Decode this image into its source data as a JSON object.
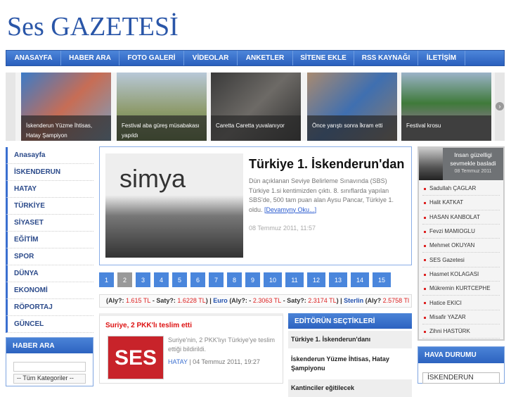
{
  "logo": "Ses GAZETESİ",
  "nav": [
    "ANASAYFA",
    "HABER ARA",
    "FOTO GALERİ",
    "VİDEOLAR",
    "ANKETLER",
    "SİTENE EKLE",
    "RSS KAYNAĞI",
    "İLETİŞİM"
  ],
  "slides": [
    "İskenderun Yüzme İhtisas, Hatay Şampiyon",
    "Festival aba güreş müsabakası yapıldı",
    "Caretta Caretta yuvalanıyor",
    "Önce yarıştı sonra İkram etti",
    "Festival krosu"
  ],
  "sidebar": [
    "Anasayfa",
    "İSKENDERUN",
    "HATAY",
    "TÜRKİYE",
    "SİYASET",
    "EĞİTİM",
    "SPOR",
    "DÜNYA",
    "EKONOMİ",
    "RÖPORTAJ",
    "GÜNCEL"
  ],
  "search": {
    "title": "HABER ARA",
    "category": "-- Tüm Kategoriler --"
  },
  "feature": {
    "title": "Türkiye 1. İskenderun'dan",
    "text": "Dün açıklanan Seviye Belirleme Sınavında (SBS) Türkiye 1.si kentimizden çıktı. 8. sınıflarda yapılan SBS'de, 500 tam puan alan Aysu Pancar, Türkiye 1. oldu.",
    "more": "[Devamyny Oku...]",
    "date": "08 Temmuz 2011, 11:57",
    "image_text": "simya"
  },
  "pages": [
    "1",
    "2",
    "3",
    "4",
    "5",
    "6",
    "7",
    "8",
    "9",
    "10",
    "11",
    "12",
    "13",
    "14",
    "15"
  ],
  "currency": {
    "a1": "(Aly?: ",
    "v1": "1.615 TL",
    "a2": " - Saty?: ",
    "v2": "1.6228 TL",
    "a3": ")  |  ",
    "euro": "Euro",
    "a4": " (Aly?: - ",
    "v3": "2.3063 TL",
    "a5": " - Saty?: ",
    "v4": "2.3174 TL",
    "a6": ")  |  ",
    "sterlin": "Sterlin",
    "a7": " (Aly? ",
    "v5": "2.5758 Tl"
  },
  "news": {
    "title": "Suriye, 2 PKK'lı teslim etti",
    "text": "Suriye'nin, 2 PKK'lıyı Türkiye'ye teslim ettiği bildirildi.",
    "category": "HATAY",
    "date": " | 04 Temmuz 2011, 19:27",
    "image_text": "SES"
  },
  "editor": {
    "title": "EDİTÖRÜN SEÇTİKLERİ",
    "items": [
      "Türkiye 1. İskenderun'danı",
      "İskenderun Yüzme İhtisas, Hatay Şampiyonu",
      "Kantinciler eğitilecek"
    ]
  },
  "author": {
    "headline": "Insan güzelligi sevmekle basladi",
    "date": "08 Temmuz 2011",
    "list": [
      "Sadullah ÇAGLAR",
      "Halit KATKAT",
      "HASAN KANBOLAT",
      "Fevzi MAMIOGLU",
      "Mehmet OKUYAN",
      "SES Gazetesi",
      "Hasmet KOLAGASI",
      "Mükremin KURTCEPHE",
      "Hatice EKICI",
      "Misafir YAZAR",
      "Zihni HASTÜRK"
    ]
  },
  "weather": {
    "title": "HAVA DURUMU",
    "city": "İSKENDERUN"
  }
}
